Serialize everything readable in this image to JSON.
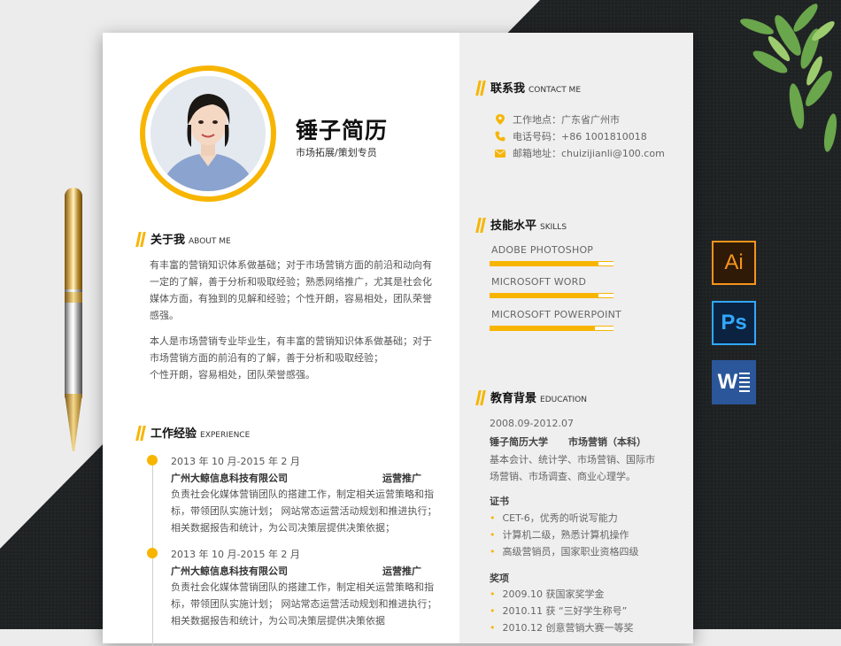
{
  "profile": {
    "name": "锤子简历",
    "role": "市场拓展/策划专员"
  },
  "about": {
    "heading_zh": "关于我",
    "heading_en": "ABOUT ME",
    "para1_lines": [
      "有丰富的营销知识体系做基础；对于市场营销方面的前沿和动向有",
      "一定的了解，善于分析和吸取经验；熟悉网络推广，尤其是社会化",
      "媒体方面，有独到的见解和经验；个性开朗，容易相处，团队荣誉",
      "感强。"
    ],
    "para2_lines": [
      "本人是市场营销专业毕业生，有丰富的营销知识体系做基础；对于",
      "市场营销方面的前沿有的了解，善于分析和吸取经验；",
      "个性开朗，容易相处，团队荣誉感强。"
    ]
  },
  "experience": {
    "heading_zh": "工作经验",
    "heading_en": "EXPERIENCE",
    "items": [
      {
        "date": "2013 年 10 月-2015 年 2 月",
        "company": "广州大鲸信息科技有限公司",
        "title": "运营推广",
        "desc_lines": [
          "负责社会化媒体营销团队的搭建工作，制定相关运营策略和指",
          "标，带领团队实施计划；  网站常态运营活动规划和推进执行；",
          "相关数据报告和统计，为公司决策层提供决策依据；"
        ]
      },
      {
        "date": "2013 年 10 月-2015 年 2 月",
        "company": "广州大鲸信息科技有限公司",
        "title": "运营推广",
        "desc_lines": [
          "负责社会化媒体营销团队的搭建工作，制定相关运营策略和指",
          "标，带领团队实施计划；  网站常态运营活动规划和推进执行；",
          "相关数据报告和统计，为公司决策层提供决策依据"
        ]
      }
    ]
  },
  "contact": {
    "heading_zh": "联系我",
    "heading_en": "CONTACT ME",
    "rows": [
      {
        "icon": "location-pin-icon",
        "text": "工作地点：广东省广州市"
      },
      {
        "icon": "phone-icon",
        "text": "电话号码：+86 1001810018"
      },
      {
        "icon": "mail-icon",
        "text": "邮箱地址：chuizijianli@100.com"
      }
    ]
  },
  "skills": {
    "heading_zh": "技能水平",
    "heading_en": "SKILLS",
    "items": [
      {
        "name": "ADOBE PHOTOSHOP",
        "level": 0.88
      },
      {
        "name": "MICROSOFT WORD",
        "level": 0.88
      },
      {
        "name": "MICROSOFT POWERPOINT",
        "level": 0.85
      }
    ]
  },
  "education": {
    "heading_zh": "教育背景",
    "heading_en": "EDUCATION",
    "period": "2008.09-2012.07",
    "school": "锤子简历大学",
    "major": "市场营销（本科）",
    "courses_lines": [
      "基本会计、统计学、市场营销、国际市",
      "场营销、市场调查、商业心理学。"
    ],
    "cert_heading": "证书",
    "certs": [
      "CET-6，优秀的听说写能力",
      "计算机二级，熟悉计算机操作",
      "高级营销员，国家职业资格四级"
    ],
    "award_heading": "奖项",
    "awards": [
      "2009.10 获国家奖学金",
      "2010.11 获  “三好学生称号”",
      "2010.12 创意营销大赛一等奖"
    ]
  },
  "apps": [
    {
      "label": "Ai",
      "color": "#f7941d",
      "bg": "#2e1a06"
    },
    {
      "label": "Ps",
      "color": "#31a8ff",
      "bg": "#0b2240"
    },
    {
      "label": "W",
      "color": "#ffffff",
      "bg": "#2b579a"
    }
  ]
}
